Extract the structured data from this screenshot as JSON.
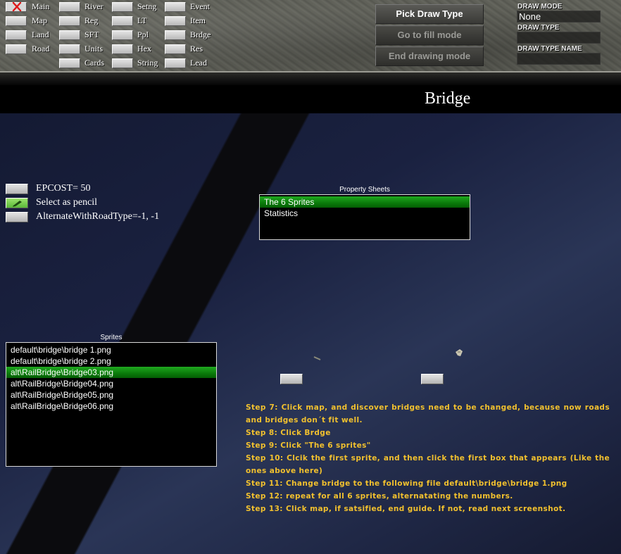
{
  "toolbar": {
    "buttons": [
      {
        "label": "Main",
        "icon": "close-icon"
      },
      {
        "label": "Map"
      },
      {
        "label": "Land"
      },
      {
        "label": "Road"
      },
      {
        "label": "River"
      },
      {
        "label": "Reg"
      },
      {
        "label": "SFT"
      },
      {
        "label": "Units"
      },
      {
        "label": "Cards"
      },
      {
        "label": "Setng"
      },
      {
        "label": "LT"
      },
      {
        "label": "Ppl"
      },
      {
        "label": "Hex"
      },
      {
        "label": "String"
      },
      {
        "label": "Event"
      },
      {
        "label": "Item"
      },
      {
        "label": "Brdge"
      },
      {
        "label": "Res"
      },
      {
        "label": "Lead"
      }
    ],
    "pick_draw_type": "Pick Draw Type",
    "go_to_fill_mode": "Go to fill mode",
    "end_drawing_mode": "End drawing mode",
    "draw_mode_label": "DRAW MODE",
    "draw_mode_value": "None",
    "draw_type_label": "DRAW TYPE",
    "draw_type_value": "",
    "draw_type_name_label": "DRAW TYPE NAME",
    "draw_type_name_value": ""
  },
  "page": {
    "title": "Bridge"
  },
  "properties": [
    {
      "label": "EPCOST= 50",
      "icon": ""
    },
    {
      "label": "Select as pencil",
      "icon": "pencil-icon"
    },
    {
      "label": "AlternateWithRoadType=-1, -1",
      "icon": ""
    }
  ],
  "property_sheets": {
    "title": "Property Sheets",
    "items": [
      "The 6 Sprites",
      "Statistics"
    ],
    "selected_index": 0
  },
  "sprites": {
    "title": "Sprites",
    "items": [
      "default\\bridge\\bridge 1.png",
      "default\\bridge\\bridge 2.png",
      "alt\\RailBridge\\Bridge03.png",
      "alt\\RailBridge\\Bridge04.png",
      "alt\\RailBridge\\Bridge05.png",
      "alt\\RailBridge\\Bridge06.png"
    ],
    "selected_index": 2
  },
  "steps": [
    "Step 7: Click map, and discover bridges need to be changed, because now roads and bridges don´t fit well.",
    "Step 8: Click Brdge",
    "Step 9: Click \"The 6 sprites\"",
    "Step 10: Clcik the first sprite, and then click the first box that appears (Like the ones above here)",
    "Step 11: Change bridge to the following file default\\bridge\\bridge 1.png",
    "Step 12: repeat for all 6 sprites, alternatating the numbers.",
    "Step 13: Click map, if satsified, end guide. If not, read next screenshot."
  ],
  "colors": {
    "accent_green": "#1fa81f",
    "step_text": "#f2c12e",
    "close_red": "#e01818"
  }
}
